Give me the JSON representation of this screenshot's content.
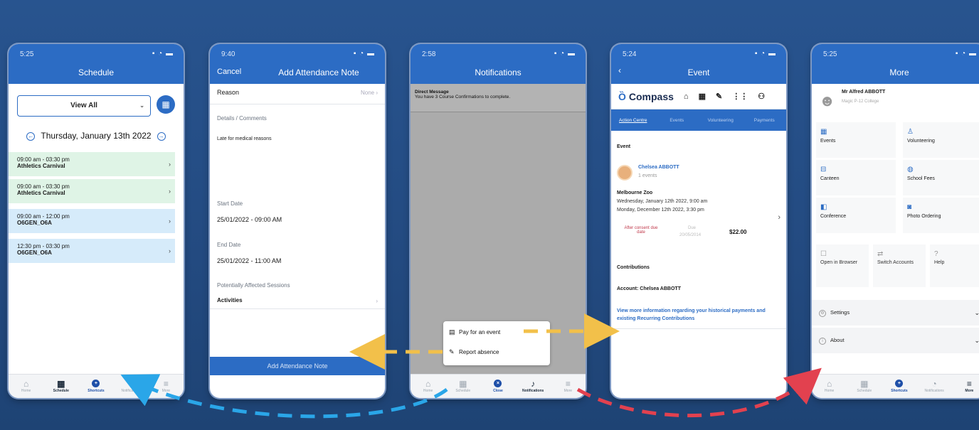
{
  "screen1": {
    "status": "5:25",
    "title": "Schedule",
    "filter": "View All",
    "date": "Thursday, January 13th 2022",
    "events": [
      {
        "time": "09:00 am - 03:30 pm",
        "name": "Athletics Carnival",
        "color": "#dff4e6"
      },
      {
        "time": "09:00 am - 03:30 pm",
        "name": "Athletics Carnival",
        "color": "#dff4e6"
      },
      {
        "time": "09:00 am - 12:00 pm",
        "name": "O6GEN_O6A",
        "color": "#d6ebfa"
      },
      {
        "time": "12:30 pm - 03:30 pm",
        "name": "O6GEN_O6A",
        "color": "#d6ebfa"
      }
    ],
    "tabs": [
      "Home",
      "Schedule",
      "Shortcuts",
      "Notifications",
      "More"
    ]
  },
  "screen2": {
    "status": "9:40",
    "cancel": "Cancel",
    "title": "Add Attendance Note",
    "reason_label": "Reason",
    "reason_value": "None",
    "details_label": "Details / Comments",
    "details_value": "Late for medical reasons",
    "start_label": "Start Date",
    "start_value": "25/01/2022 - 09:00 AM",
    "end_label": "End Date",
    "end_value": "25/01/2022 - 11:00 AM",
    "sessions_label": "Potentially Affected Sessions",
    "sessions_value": "Activities",
    "button": "Add Attendance Note"
  },
  "screen3": {
    "status": "2:58",
    "title": "Notifications",
    "msg_title": "Direct Message",
    "msg_body": "You have 3 Course Confirmations to complete.",
    "pay": "Pay for an event",
    "report": "Report absence",
    "tabs": [
      "Home",
      "Schedule",
      "Close",
      "Notifications",
      "More"
    ]
  },
  "screen4": {
    "status": "5:24",
    "title": "Event",
    "brand": "Compass",
    "tabs": [
      "Action Centre",
      "Events",
      "Volunteering",
      "Payments"
    ],
    "section": "Event",
    "person": "Chelsea ABBOTT",
    "person_sub": "1 events",
    "event_name": "Melbourne Zoo",
    "event_date1": "Wednesday, January 12th 2022, 9:00 am",
    "event_date2": "Monday, December 12th 2022, 3:30 pm",
    "consent": "After consent due date",
    "due": "Due",
    "due_date": "20/05/2014",
    "amount": "$22.00",
    "contributions": "Contributions",
    "account": "Account: Chelsea ABBOTT",
    "link": "View more information regarding your historical payments and existing Recurring Contributions"
  },
  "screen5": {
    "status": "5:25",
    "title": "More",
    "user": "Mr Alfred ABBOTT",
    "school": "Magic P-12 College",
    "items": [
      "Events",
      "Volunteering",
      "Canteen",
      "School Fees",
      "Conference",
      "Photo Ordering"
    ],
    "items3": [
      "Open in Browser",
      "Switch Accounts",
      "Help"
    ],
    "settings": "Settings",
    "about": "About",
    "tabs": [
      "Home",
      "Schedule",
      "Shortcuts",
      "Notifications",
      "More"
    ]
  }
}
